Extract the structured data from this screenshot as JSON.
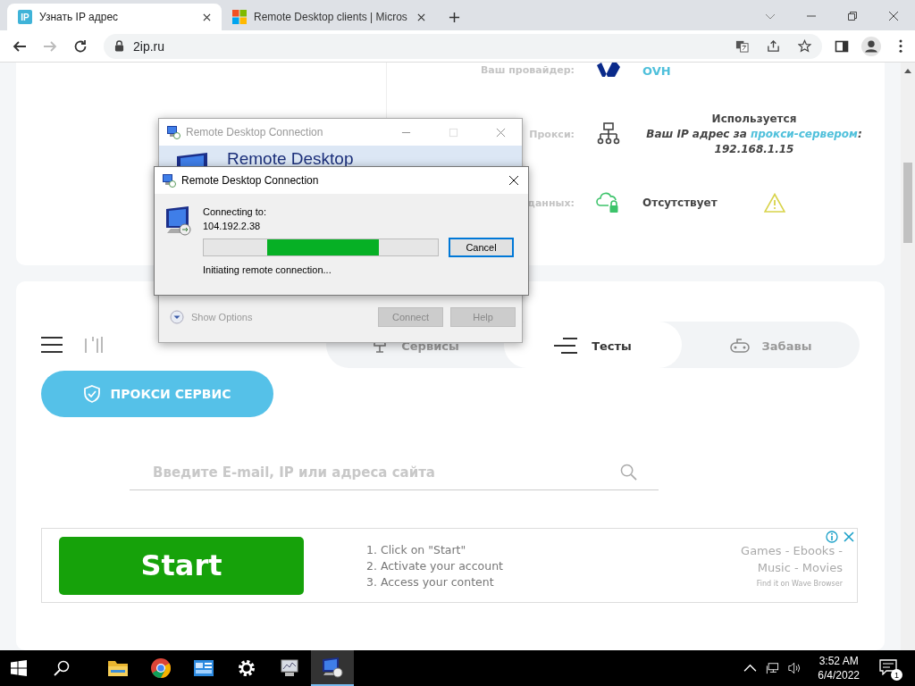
{
  "browser": {
    "tabs": [
      {
        "kind": "text-favicon",
        "favicon_text": "IP",
        "title": "Узнать IP адрес",
        "selected": true
      },
      {
        "kind": "tiles-favicon",
        "title": "Remote Desktop clients | Micros",
        "selected": false
      }
    ],
    "address": "2ip.ru",
    "forward_disabled": true
  },
  "info_card": {
    "rows": [
      {
        "kind": "provider",
        "label": "Ваш провайдер:",
        "value": "OVH"
      },
      {
        "kind": "proxy",
        "label": "Прокси:",
        "status": "Используется",
        "note": "Ваш IP адрес за ",
        "link": "прокси-сервером",
        "note_end": ":",
        "ip": "192.168.1.15"
      },
      {
        "kind": "data",
        "label": "данных:",
        "status": "Отсутствует",
        "warning": true
      }
    ]
  },
  "nav": {
    "items": [
      {
        "kind": "services",
        "label": "Сервисы",
        "selected": false
      },
      {
        "kind": "tests",
        "label": "Тесты",
        "selected": true
      },
      {
        "kind": "games",
        "label": "Забавы",
        "selected": false
      }
    ]
  },
  "proxy_button": "ПРОКСИ СЕРВИС",
  "search": {
    "placeholder": "Введите E-mail, IP или адреса сайта"
  },
  "ad": {
    "button": "Start",
    "steps": [
      "1. Click on \"Start\"",
      "2. Activate your account",
      "3. Access your content"
    ],
    "tagline_lines": [
      "Games - Ebooks -",
      "Music - Movies"
    ],
    "source": "Find it on Wave Browser"
  },
  "back_dialog": {
    "title": "Remote Desktop Connection",
    "active": false,
    "banner": "Remote Desktop",
    "show_options": "Show Options",
    "buttons": [
      "Connect",
      "Help"
    ]
  },
  "dialog": {
    "title": "Remote Desktop Connection",
    "active": true,
    "label": "Connecting to:",
    "address": "104.192.2.38",
    "progress": {
      "level": 0.48
    },
    "button": "Cancel",
    "status": "Initiating remote connection..."
  },
  "taskbar": {
    "apps": [
      {
        "kind": "folder",
        "selected": false
      },
      {
        "kind": "chrome",
        "selected": false
      },
      {
        "kind": "panel",
        "selected": false
      },
      {
        "kind": "gear",
        "selected": false
      },
      {
        "kind": "monitor",
        "selected": false
      },
      {
        "kind": "remote",
        "selected": true
      }
    ],
    "time": "3:52 AM",
    "date": "6/4/2022",
    "notifications": "1"
  }
}
